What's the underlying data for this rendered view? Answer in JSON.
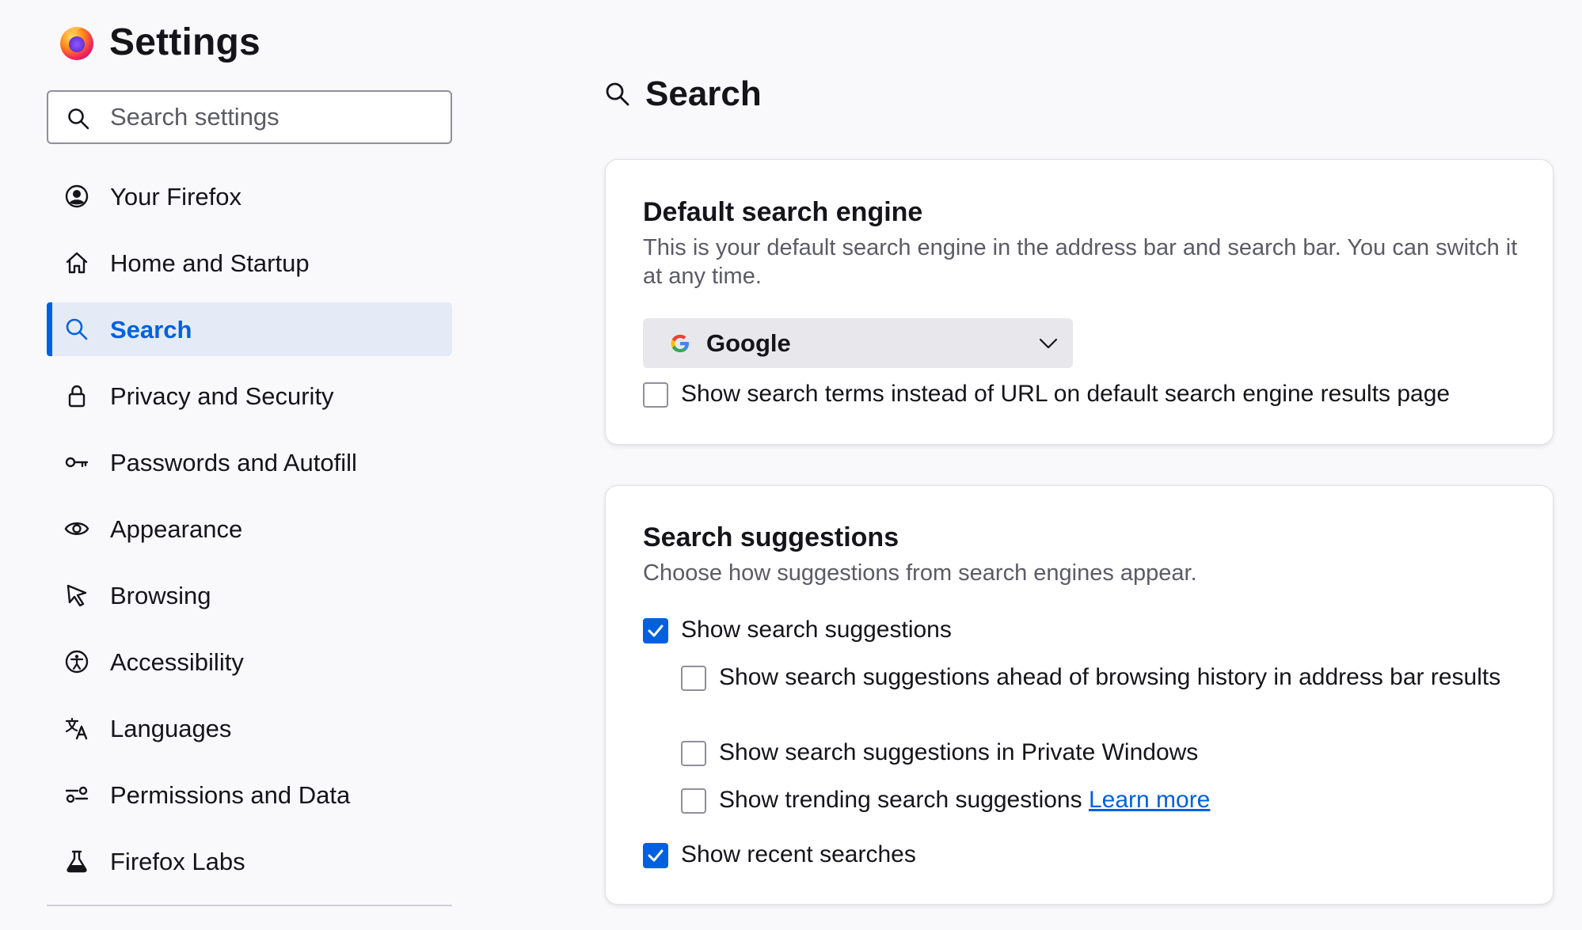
{
  "app": {
    "title": "Settings"
  },
  "sidebar": {
    "search": {
      "placeholder": "Search settings",
      "value": ""
    },
    "items": [
      {
        "label": "Your Firefox",
        "icon": "account-icon",
        "active": false
      },
      {
        "label": "Home and Startup",
        "icon": "home-icon",
        "active": false
      },
      {
        "label": "Search",
        "icon": "search-icon",
        "active": true
      },
      {
        "label": "Privacy and Security",
        "icon": "lock-icon",
        "active": false
      },
      {
        "label": "Passwords and Autofill",
        "icon": "key-icon",
        "active": false
      },
      {
        "label": "Appearance",
        "icon": "eye-icon",
        "active": false
      },
      {
        "label": "Browsing",
        "icon": "cursor-icon",
        "active": false
      },
      {
        "label": "Accessibility",
        "icon": "accessibility-icon",
        "active": false
      },
      {
        "label": "Languages",
        "icon": "translate-icon",
        "active": false
      },
      {
        "label": "Permissions and Data",
        "icon": "permissions-icon",
        "active": false
      },
      {
        "label": "Firefox Labs",
        "icon": "flask-icon",
        "active": false
      }
    ]
  },
  "main": {
    "title": "Search",
    "engine": {
      "title": "Default search engine",
      "description": "This is your default search engine in the address bar and search bar. You can switch it at any time.",
      "selected": "Google",
      "checkbox": {
        "label": "Show search terms instead of URL on default search engine results page",
        "checked": false
      }
    },
    "suggestions": {
      "title": "Search suggestions",
      "description": "Choose how suggestions from search engines appear.",
      "show_suggestions": {
        "label": "Show search suggestions",
        "checked": true
      },
      "ahead_of_history": {
        "label": "Show search suggestions ahead of browsing history in address bar results",
        "checked": false
      },
      "private_windows": {
        "label": "Show search suggestions in Private Windows",
        "checked": false
      },
      "trending": {
        "label": "Show trending search suggestions",
        "link": "Learn more",
        "checked": false
      },
      "recent": {
        "label": "Show recent searches",
        "checked": true
      }
    }
  },
  "colors": {
    "accent": "#0061e0",
    "active_bg": "#e5ebf6",
    "page_bg": "#f9f9fb",
    "secondary_text": "#5b5b66"
  }
}
